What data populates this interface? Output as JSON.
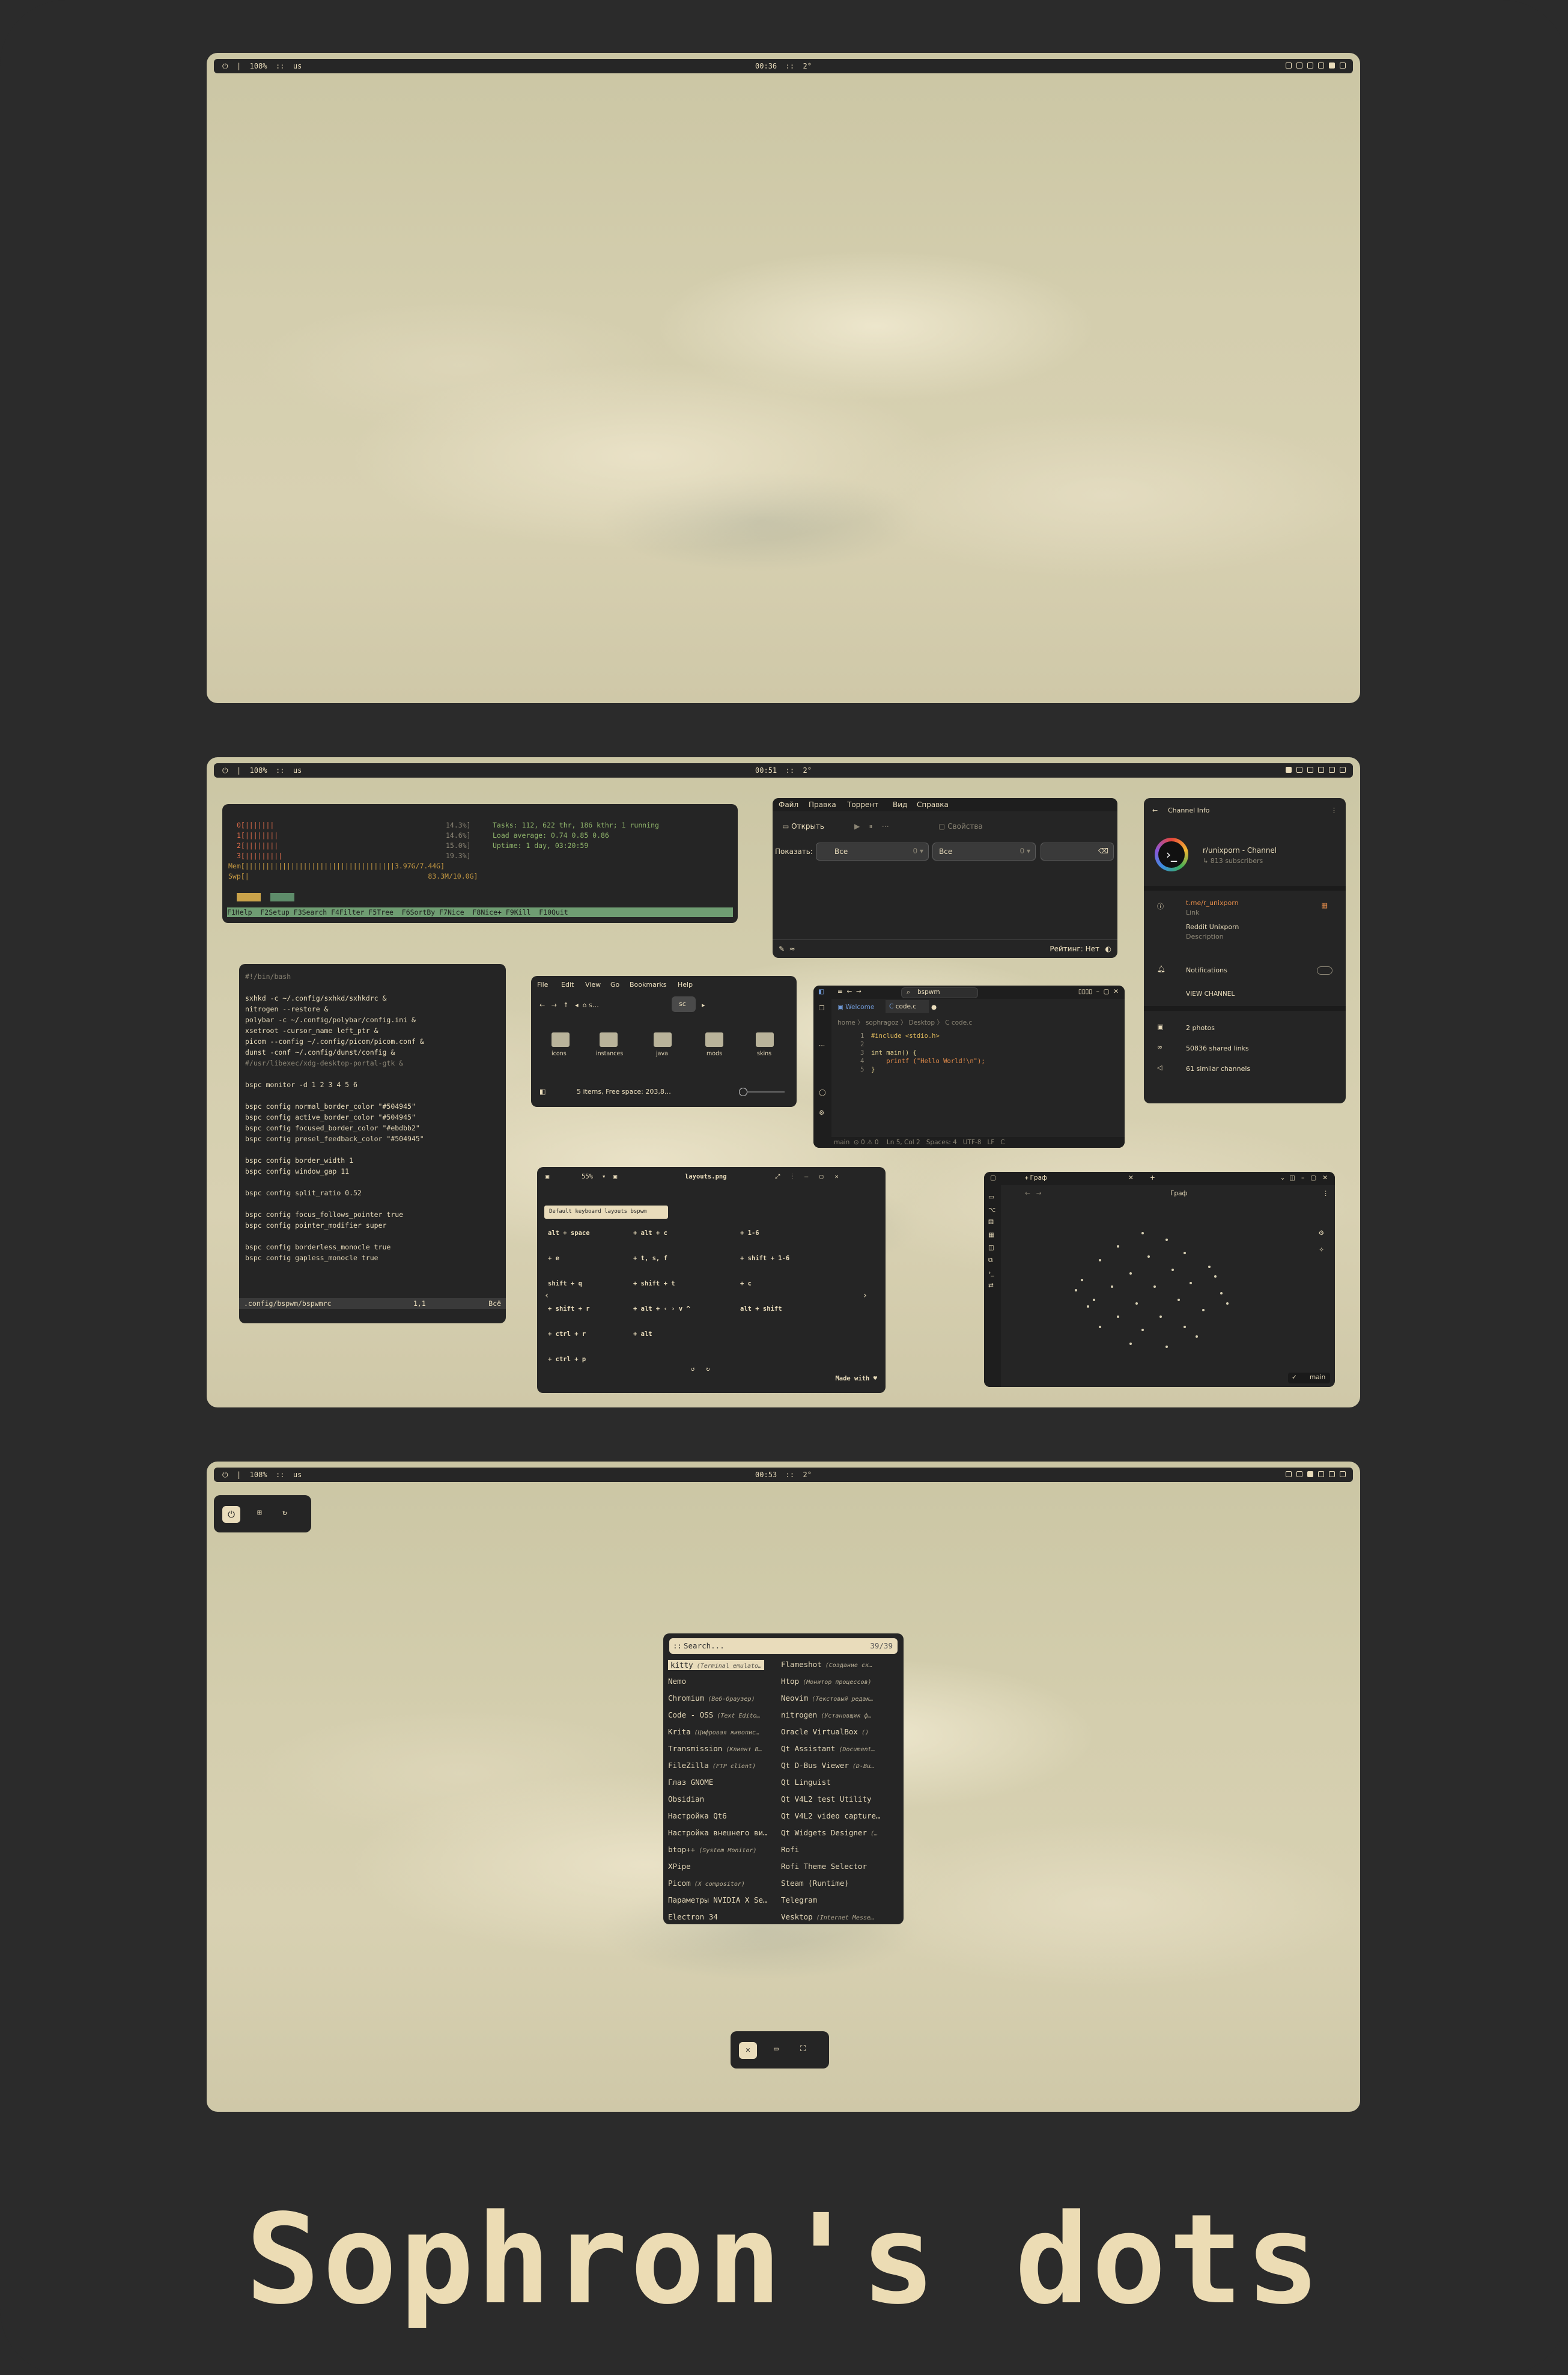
{
  "screens": [
    {
      "bar": {
        "left": "⏻  |  108%  ::  us",
        "center": "00:36  ::  2°"
      }
    },
    {
      "bar": {
        "left": "⏻  |  108%  ::  us",
        "center": "00:51  ::  2°"
      }
    },
    {
      "bar": {
        "left": "⏻  |  108%  ::  us",
        "center": "00:53  ::  2°"
      }
    }
  ],
  "htop": {
    "cpu": [
      "0[|||||||",
      "1[||||||||",
      "2[||||||||",
      "3[|||||||||"
    ],
    "cpu_pct": [
      "14.3%]",
      "14.6%]",
      "15.0%]",
      "19.3%]"
    ],
    "mem": "Mem[||||||||||||||||||||||||||||||||||||3.97G/7.44G]",
    "swp": "Swp[|                                           83.3M/10.0G]",
    "tasks": "Tasks: 112, 622 thr, 186 kthr; 1 running",
    "load": "Load average: 0.74 0.85 0.86",
    "uptime": "Uptime: 1 day, 03:20:59",
    "fkeys": "F1Help  F2Setup F3Search F4Filter F5Tree  F6SortBy F7Nice  F8Nice+ F9Kill  F10Quit"
  },
  "bspwmrc": {
    "lines": [
      "#!/bin/bash",
      "",
      "sxhkd -c ~/.config/sxhkd/sxhkdrc &",
      "nitrogen --restore &",
      "polybar -c ~/.config/polybar/config.ini &",
      "xsetroot -cursor_name left_ptr &",
      "picom --config ~/.config/picom/picom.conf &",
      "dunst -conf ~/.config/dunst/config &",
      "#/usr/libexec/xdg-desktop-portal-gtk &",
      "",
      "bspc monitor -d 1 2 3 4 5 6",
      "",
      "bspc config normal_border_color \"#504945\"",
      "bspc config active_border_color \"#504945\"",
      "bspc config focused_border_color \"#ebdbb2\"",
      "bspc config presel_feedback_color \"#504945\"",
      "",
      "bspc config border_width 1",
      "bspc config window_gap 11",
      "",
      "bspc config split_ratio 0.52",
      "",
      "bspc config focus_follows_pointer true",
      "bspc config pointer_modifier super",
      "",
      "bspc config borderless_monocle true",
      "bspc config gapless_monocle true"
    ],
    "status_file": ".config/bspwm/bspwmrc",
    "status_pos": "1,1",
    "status_all": "Всё"
  },
  "torrent": {
    "menu": [
      "Файл",
      "Правка",
      "Торрент",
      "Вид",
      "Справка"
    ],
    "open": "Открыть",
    "props": "Свойства",
    "show": "Показать:",
    "filter1": "Все",
    "filter2": "Все",
    "rating": "Рейтинг: Нет"
  },
  "telegram": {
    "title": "Channel Info",
    "channel": "r/unixporn - Channel",
    "subs": "↳ 813 subscribers",
    "link": "t.me/r_unixporn",
    "link_label": "Link",
    "desc": "Reddit Unixporn",
    "desc_label": "Description",
    "notif": "Notifications",
    "view": "VIEW CHANNEL",
    "photos": "2 photos",
    "links": "50836 shared links",
    "similar": "61 similar channels"
  },
  "files": {
    "menu": [
      "File",
      "Edit",
      "View",
      "Go",
      "Bookmarks",
      "Help"
    ],
    "crumb": "sc",
    "folders": [
      "icons",
      "instances",
      "java",
      "mods",
      "skins"
    ],
    "status": "5 items, Free space: 203,8…"
  },
  "vscode": {
    "search": "bspwm",
    "tabs": [
      "Welcome",
      "code.c"
    ],
    "crumb": "home 〉 sophragoz 〉 Desktop 〉 C code.c",
    "code": [
      "#include <stdio.h>",
      "",
      "int main() {",
      "    printf (\"Hello World!\\n\");",
      "}"
    ],
    "status": "main  ⊙ 0 ⚠ 0    Ln 5, Col 2   Spaces: 4   UTF-8   LF   C"
  },
  "viewer": {
    "zoom": "55%",
    "file": "layouts.png",
    "banner": "Default keyboard layouts bspwm",
    "made": "Made with ♥",
    "binds": [
      "alt + space",
      "+ e",
      "shift + q",
      "+ shift + r",
      "+ ctrl + r",
      "+ ctrl + p",
      "+ alt + c",
      "+ t, s, f",
      "+ shift + t",
      "+ alt + ‹ › v ^",
      "+ alt",
      "+ 1-6",
      "+ shift + 1-6",
      "+ c",
      "alt + shift"
    ]
  },
  "graph": {
    "tab": "Граф",
    "title": "Граф",
    "branch": "main"
  },
  "launcher": {
    "prompt": "::",
    "query": "Search...",
    "count": "39/39",
    "left": [
      [
        "kitty",
        "(Terminal emulato…"
      ],
      [
        "Nemo",
        ""
      ],
      [
        "Chromium",
        "(Веб-браузер)"
      ],
      [
        "Code - OSS",
        "(Text Edito…"
      ],
      [
        "Krita",
        "(Цифровая живопис…"
      ],
      [
        "Transmission",
        "(Клиент B…"
      ],
      [
        "FileZilla",
        "(FTP client)"
      ],
      [
        "Глаз GNOME",
        ""
      ],
      [
        "Obsidian",
        ""
      ],
      [
        "Настройка Qt6",
        ""
      ],
      [
        "Настройка внешнего ви…",
        ""
      ],
      [
        "btop++",
        "(System Monitor)"
      ],
      [
        "XPipe",
        ""
      ],
      [
        "Picom",
        "(X compositor)"
      ],
      [
        "Параметры NVIDIA X Se…",
        ""
      ],
      [
        "Electron 34",
        ""
      ]
    ],
    "right": [
      [
        "Flameshot",
        "(Создание ск…"
      ],
      [
        "Htop",
        "(Монитор процессов)"
      ],
      [
        "Neovim",
        "(Текстовый редак…"
      ],
      [
        "nitrogen",
        "(Установщик ф…"
      ],
      [
        "Oracle VirtualBox",
        "()"
      ],
      [
        "Qt Assistant",
        "(Document…"
      ],
      [
        "Qt D-Bus Viewer",
        "(D-Bu…"
      ],
      [
        "Qt Linguist",
        ""
      ],
      [
        "Qt V4L2 test Utility",
        ""
      ],
      [
        "Qt V4L2 video capture…",
        ""
      ],
      [
        "Qt Widgets Designer",
        "(…"
      ],
      [
        "Rofi",
        ""
      ],
      [
        "Rofi Theme Selector",
        ""
      ],
      [
        "Steam (Runtime)",
        ""
      ],
      [
        "Telegram",
        ""
      ],
      [
        "Vesktop",
        "(Internet Messe…"
      ]
    ]
  },
  "title": "Sophron's dots"
}
